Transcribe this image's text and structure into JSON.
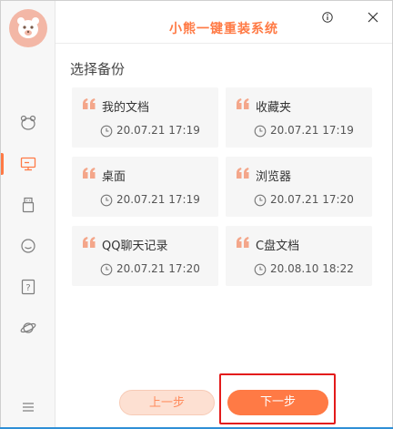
{
  "app": {
    "title": "小熊一键重装系统"
  },
  "colors": {
    "accent": "#ff7a45",
    "accent_light": "#fde0d2",
    "highlight": "#e31b1b"
  },
  "main": {
    "section_title": "选择备份",
    "items": [
      {
        "name": "我的文档",
        "time": "20.07.21 17:19"
      },
      {
        "name": "收藏夹",
        "time": "20.07.21 17:19"
      },
      {
        "name": "桌面",
        "time": "20.07.21 17:19"
      },
      {
        "name": "浏览器",
        "time": "20.07.21 17:20"
      },
      {
        "name": "QQ聊天记录",
        "time": "20.07.21 17:20"
      },
      {
        "name": "C盘文档",
        "time": "20.08.10 18:22"
      }
    ]
  },
  "footer": {
    "prev_label": "上一步",
    "next_label": "下一步"
  },
  "sidebar": {
    "icons": [
      "bear-icon",
      "monitor-icon",
      "usb-drive-icon",
      "chat-bubble-icon",
      "help-icon",
      "planet-icon",
      "menu-icon"
    ]
  }
}
